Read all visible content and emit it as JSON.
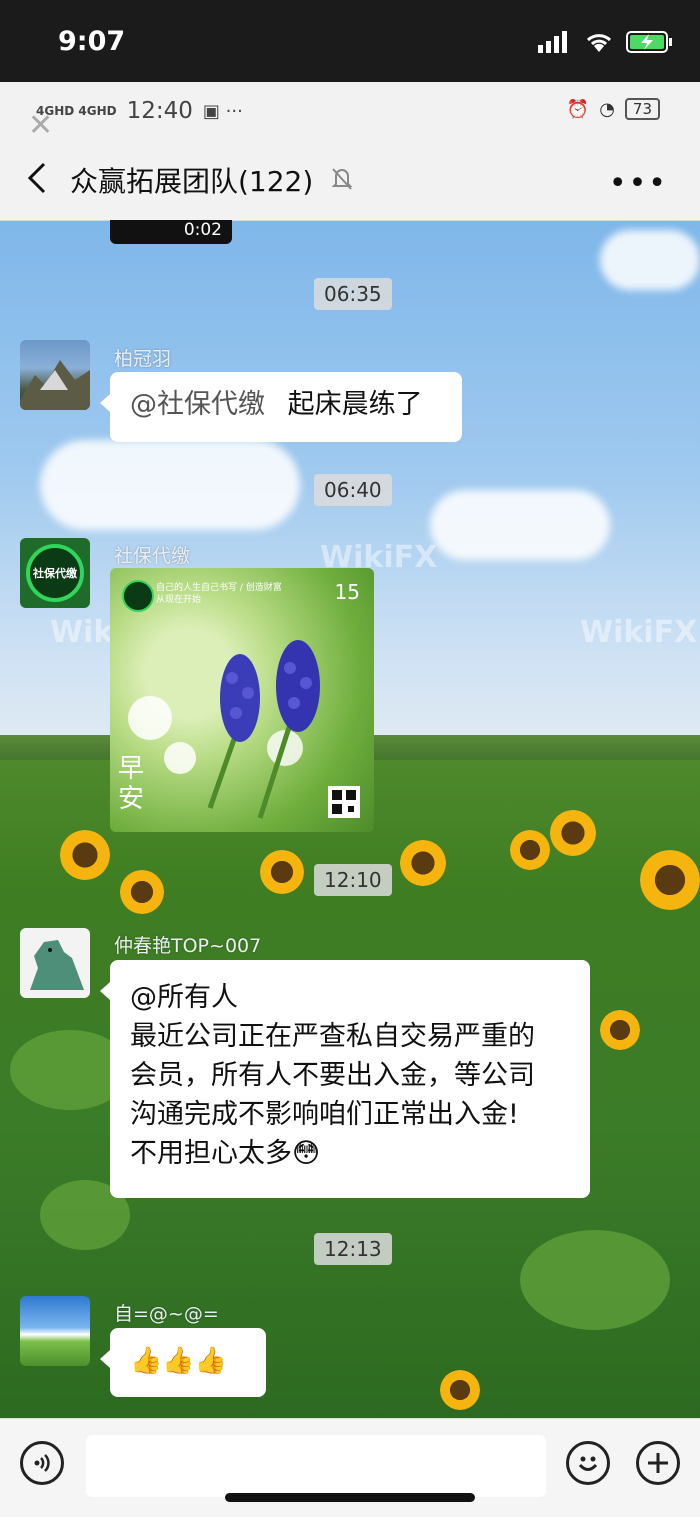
{
  "os_status": {
    "time": "9:07"
  },
  "inner_status": {
    "network_left": "4GHD 4GHD",
    "time": "12:40",
    "battery": "73"
  },
  "header": {
    "title": "众赢拓展团队(122)"
  },
  "video_duration": "0:02",
  "timestamps": [
    "06:35",
    "06:40",
    "12:10",
    "12:13"
  ],
  "messages": [
    {
      "sender": "柏冠羽",
      "mention": "@社保代缴",
      "text": "起床晨练了"
    },
    {
      "sender": "社保代缴",
      "avatar_text": "社保代缴",
      "image": {
        "top_text": "自己的人生自己书写 / 创造财富从现在开始",
        "date": "15",
        "caption": "早安"
      }
    },
    {
      "sender": "仲春艳TOP~007",
      "lines": [
        "@所有人",
        "最近公司正在严查私自交易严重的",
        "会员，所有人不要出入金，等公司",
        "沟通完成不影响咱们正常出入金!",
        "不用担心太多😳"
      ]
    },
    {
      "sender": "自=@~@=",
      "text": "👍👍👍"
    }
  ],
  "watermark": "WikiFX",
  "colors": {
    "header_bg": "#f2f2f2",
    "bubble_bg": "#ffffff",
    "accent_green": "#07c160"
  }
}
